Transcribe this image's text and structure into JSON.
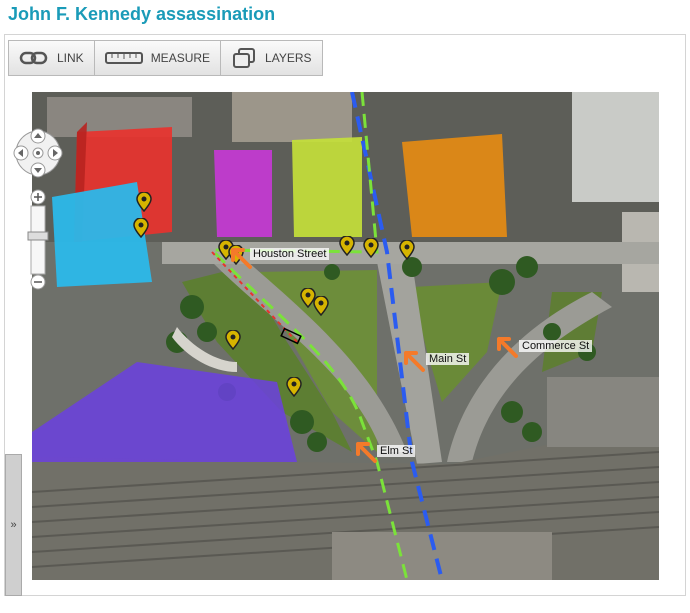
{
  "page": {
    "title": "John F. Kennedy assassination"
  },
  "toolbar": {
    "items": [
      {
        "label": "LINK",
        "icon": "link-icon"
      },
      {
        "label": "MEASURE",
        "icon": "ruler-icon"
      },
      {
        "label": "LAYERS",
        "icon": "layers-icon"
      }
    ]
  },
  "map": {
    "street_labels": {
      "houston": "Houston Street",
      "main": "Main St",
      "commerce": "Commerce St",
      "elm": "Elm St"
    },
    "colors": {
      "red_building": "#e8332e",
      "cyan_building": "#2bb8ea",
      "magenta_building": "#c63ad4",
      "yellow_building": "#c4e03a",
      "orange_building": "#e58b12",
      "purple_area": "#6b3fe0",
      "green_route": "#7be23a",
      "blue_route": "#2b5cf0",
      "arrow": "#f47a2a",
      "pin": "#d6b400"
    }
  },
  "side_toggle": {
    "label": "»"
  }
}
